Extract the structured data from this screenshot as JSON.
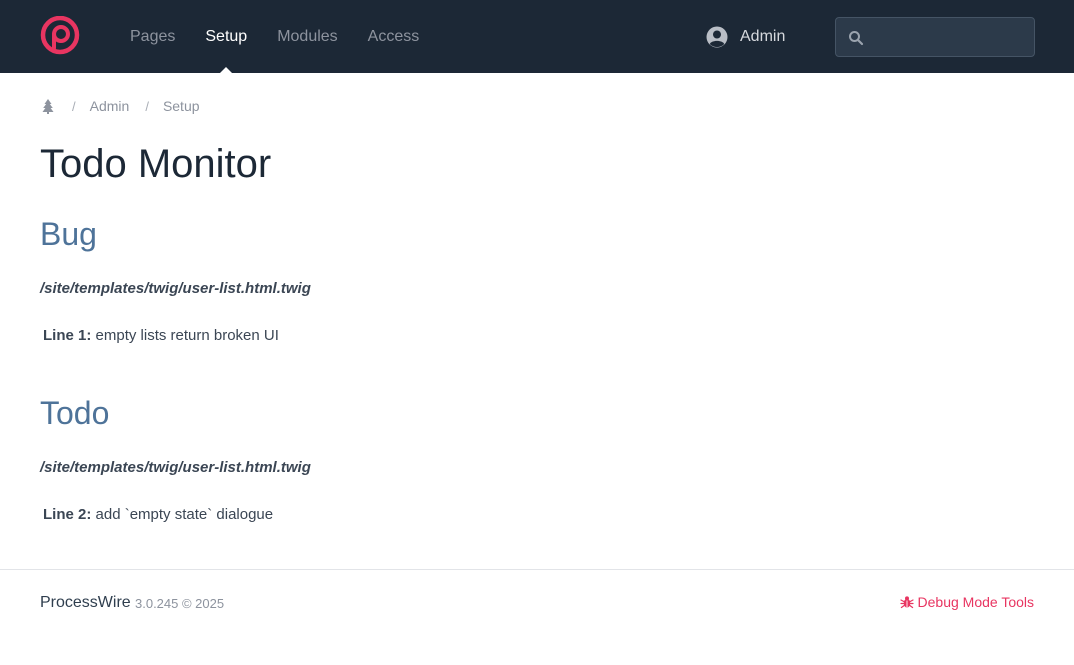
{
  "header": {
    "nav": [
      {
        "label": "Pages",
        "active": false
      },
      {
        "label": "Setup",
        "active": true
      },
      {
        "label": "Modules",
        "active": false
      },
      {
        "label": "Access",
        "active": false
      }
    ],
    "user_label": "Admin",
    "search": {
      "placeholder": "",
      "value": ""
    }
  },
  "breadcrumb": {
    "items": [
      "Admin",
      "Setup"
    ],
    "separator": "/"
  },
  "page": {
    "title": "Todo Monitor"
  },
  "sections": [
    {
      "title": "Bug",
      "file": "/site/templates/twig/user-list.html.twig",
      "entries": [
        {
          "line_label": "Line 1:",
          "text": " empty lists return broken UI"
        }
      ]
    },
    {
      "title": "Todo",
      "file": "/site/templates/twig/user-list.html.twig",
      "entries": [
        {
          "line_label": "Line 2:",
          "text": " add `empty state` dialogue"
        }
      ]
    }
  ],
  "footer": {
    "brand": "ProcessWire",
    "version": "3.0.245 © 2025",
    "debug_label": "Debug Mode Tools"
  },
  "colors": {
    "masthead": "#1c2836",
    "logo": "#e83561",
    "section_heading": "#4e7399",
    "debug_link": "#e83561"
  },
  "icons": {
    "logo": "processwire-logo-icon",
    "user": "user-circle-icon",
    "search": "search-icon",
    "home": "tree-icon",
    "debug": "bug-icon"
  }
}
